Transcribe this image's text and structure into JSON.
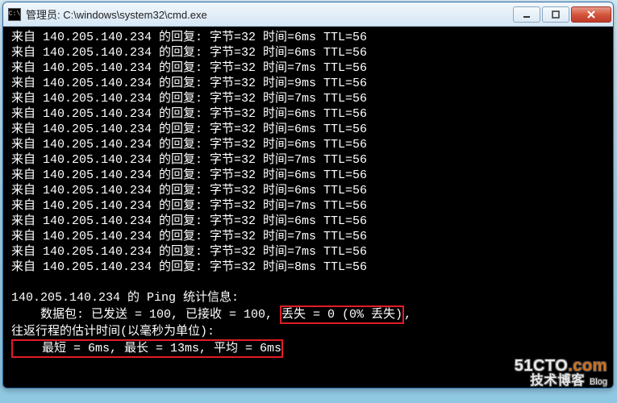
{
  "window": {
    "title": "管理员: C:\\windows\\system32\\cmd.exe"
  },
  "ping": {
    "ip": "140.205.140.234",
    "reply_prefix": "来自 ",
    "reply_mid": " 的回复: 字节=",
    "bytes": 32,
    "time_label": "时间=",
    "ttl_label": "TTL=",
    "ttl": 56,
    "replies_ms": [
      6,
      6,
      7,
      9,
      7,
      6,
      6,
      6,
      7,
      6,
      6,
      7,
      6,
      7,
      7,
      8
    ],
    "stats_header_a": " 的 Ping 统计信息:",
    "packets_line_a": "    数据包: 已发送 = ",
    "sent": 100,
    "packets_line_b": ", 已接收 = ",
    "recv": 100,
    "packets_line_c": ", ",
    "loss_box": "丢失 = 0 (0% 丢失)",
    "packets_line_d": ",",
    "rtt_header": "往返行程的估计时间(以毫秒为单位):",
    "rtt_box": "    最短 = 6ms, 最长 = 13ms, 平均 = 6ms"
  },
  "watermark": {
    "line1a": "51CTO",
    "line1b": ".com",
    "line2a": "技术博客",
    "line2b": "Blog"
  }
}
